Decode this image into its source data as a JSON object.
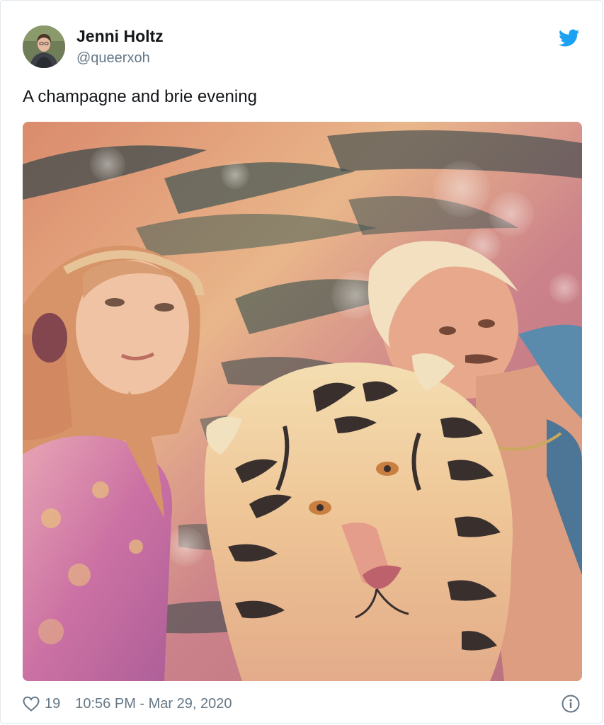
{
  "author": {
    "display_name": "Jenni Holtz",
    "handle": "@queerxoh",
    "avatar_icon": "profile-photo"
  },
  "tweet": {
    "text": "A champagne and brie evening",
    "media_description_icon": "photo-collage-two-people-with-tiger"
  },
  "footer": {
    "like_icon": "heart-icon",
    "like_count": "19",
    "timestamp": "10:56 PM - Mar 29, 2020",
    "info_icon": "info-icon"
  },
  "colors": {
    "twitter_blue": "#1da1f2",
    "text_primary": "#14171a",
    "text_secondary": "#657786",
    "border": "#e1e8ed"
  }
}
